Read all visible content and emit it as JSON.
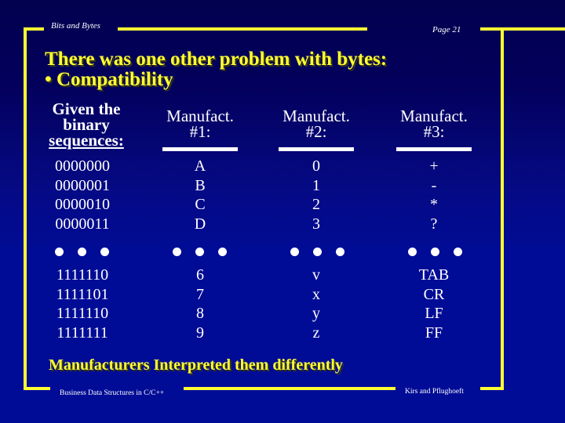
{
  "header": {
    "section": "Bits and Bytes",
    "page": "Page 21"
  },
  "title": {
    "line1": "There was one other problem with bytes:",
    "line2": "• Compatibility"
  },
  "table": {
    "binary_header": {
      "line1": "Given the",
      "line2": "binary",
      "line3": "sequences:"
    },
    "manufacturers": [
      {
        "line1": "Manufact.",
        "line2": "#1:"
      },
      {
        "line1": "Manufact.",
        "line2": "#2:"
      },
      {
        "line1": "Manufact.",
        "line2": "#3:"
      }
    ],
    "top_rows": {
      "binary": [
        "0000000",
        "0000001",
        "0000010",
        "0000011"
      ],
      "m1": [
        "A",
        "B",
        "C",
        "D"
      ],
      "m2": [
        "0",
        "1",
        "2",
        "3"
      ],
      "m3": [
        "+",
        "-",
        "*",
        "?"
      ]
    },
    "bottom_rows": {
      "binary": [
        "1111110",
        "1111101",
        "1111110",
        "1111111"
      ],
      "m1": [
        "6",
        "7",
        "8",
        "9"
      ],
      "m2": [
        "v",
        "x",
        "y",
        "z"
      ],
      "m3": [
        "TAB",
        "CR",
        "LF",
        "FF"
      ]
    },
    "ellipsis_icon": "three-dots"
  },
  "conclusion": "Manufacturers Interpreted them differently",
  "footer": {
    "course": "Business Data Structures in C/C++",
    "authors": "Kirs and Pflughoeft"
  },
  "colors": {
    "frame": "#ffff33",
    "title": "#ffff33",
    "text": "#ffffff",
    "background_top": "#02004f",
    "background_bottom": "#000c96"
  }
}
